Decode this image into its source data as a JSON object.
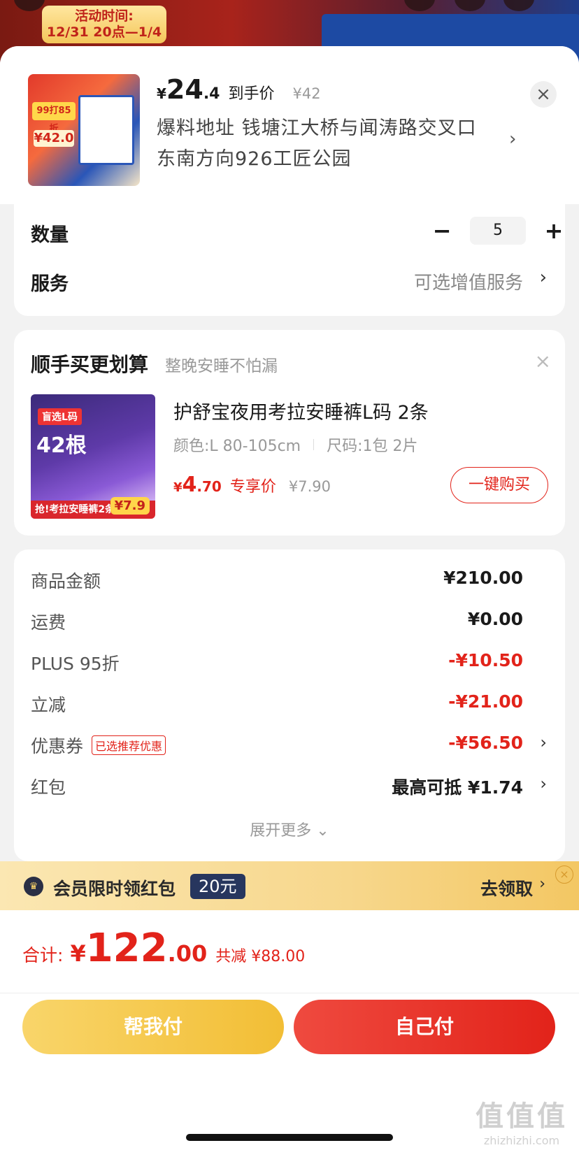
{
  "banner": {
    "event_line1": "活动时间:",
    "event_line2": "12/31 20点—1/4"
  },
  "product": {
    "thumb_tag1": "99打85折",
    "thumb_tag2": "¥42.0",
    "price_yen": "¥",
    "price_int": "24",
    "price_dec": ".4",
    "price_label": "到手价",
    "original_price": "¥42",
    "address": "爆料地址  钱塘江大桥与闻涛路交叉口东南方向926工匠公园"
  },
  "quantity": {
    "label": "数量",
    "minus": "−",
    "value": "5",
    "plus": "+"
  },
  "service": {
    "label": "服务",
    "value": "可选增值服务"
  },
  "addon": {
    "title": "顺手买更划算",
    "subtitle": "整晚安睡不怕漏",
    "thumb_tag": "盲选L码",
    "thumb_big": "42根",
    "thumb_bottom": "抢!考拉安睡裤2条",
    "thumb_price": "¥7.9",
    "name": "护舒宝夜用考拉安睡裤L码 2条",
    "spec_color": "颜色:L 80-105cm",
    "spec_size": "尺码:1包 2片",
    "price_yen": "¥",
    "price_int": "4",
    "price_dec": ".70",
    "price_label": "专享价",
    "original_price": "¥7.90",
    "buy_label": "一键购买"
  },
  "fees": {
    "rows": [
      {
        "label": "商品金额",
        "value": "¥210.00"
      },
      {
        "label": "运费",
        "value": "¥0.00"
      },
      {
        "label": "PLUS 95折",
        "value": "-¥10.50"
      },
      {
        "label": "立减",
        "value": "-¥21.00"
      },
      {
        "label": "优惠券",
        "tag": "已选推荐优惠",
        "value": "-¥56.50"
      },
      {
        "label": "红包",
        "value": "最高可抵 ¥1.74"
      }
    ],
    "expand_label": "展开更多"
  },
  "member": {
    "text": "会员限时领红包",
    "amount": "20元",
    "action": "去领取"
  },
  "total": {
    "label": "合计:",
    "yen": "¥",
    "int": "122",
    "dec": ".00",
    "saved": "共减 ¥88.00"
  },
  "buttons": {
    "help_pay": "帮我付",
    "self_pay": "自己付"
  },
  "watermark": {
    "big": "值值值",
    "small": "zhizhizhi.com"
  },
  "colors": {
    "accent_red": "#e2231a",
    "gold": "#f2be35"
  }
}
